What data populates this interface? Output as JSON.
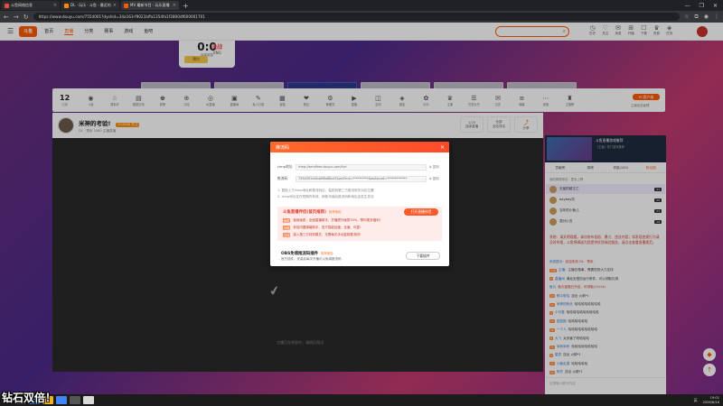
{
  "browser": {
    "tabs": [
      {
        "title": "斗鱼网络信息",
        "color": "#e74c3c",
        "active": false
      },
      {
        "title": "DL · 玩乐 · 斗鱼 · 最近的直播",
        "color": "#ff8a00",
        "active": false
      },
      {
        "title": "MV 最新节目 - 玩乐直播 DL · 玩乐直播",
        "color": "#ff5a00",
        "active": true
      }
    ],
    "url": "https://www.douyu.com/7554001?dyshid=34a163-f9021bffa1354fa1f2800df600001701",
    "new_tab": "+",
    "win_min": "—",
    "win_max": "❐",
    "win_close": "✕"
  },
  "site": {
    "logo": "斗鱼",
    "nav": [
      "首页",
      "直播",
      "分类",
      "赛事",
      "游戏",
      "鱼吧"
    ],
    "nav_active_index": 1,
    "header_icons": [
      {
        "glyph": "◷",
        "label": "历史"
      },
      {
        "glyph": "♡",
        "label": "关注"
      },
      {
        "glyph": "✉",
        "label": "消息"
      },
      {
        "glyph": "⊞",
        "label": "开播"
      },
      {
        "glyph": "☐",
        "label": "下载"
      },
      {
        "glyph": "♛",
        "label": "贵族"
      },
      {
        "glyph": "◈",
        "label": "任务"
      }
    ]
  },
  "promo": {
    "score": "0:0",
    "score_label": "赢者奖励",
    "button": "预约",
    "kw": "决战",
    "kw_sub": "KNG"
  },
  "room_buttons": [
    "官方直播间",
    "Mr.Gemini直播间",
    "DL - 预米直播间",
    "eSw石苏苏直播间",
    "滴滴直播间",
    "出牌ove直播间"
  ],
  "room_active_index": 2,
  "roombar": {
    "count": "12",
    "count_label": "订阅",
    "tools": [
      "斗鱼",
      "周末好",
      "数据分析",
      "新榜",
      "订阅",
      "AI直播",
      "直播间",
      "私人订制",
      "宝箱",
      "粉丝",
      "管理员",
      "直播",
      "空间",
      "赚金",
      "乐乐",
      "主播",
      "任务大厅",
      "日志",
      "弹幕",
      "其他",
      "主播榜"
    ],
    "pc_btn": "PC客户端",
    "pc_sub": "主播信息管理"
  },
  "streamer": {
    "title": "米神的考验!",
    "fans": "522938",
    "fans_tag": "关注",
    "meta": "DL · 预米   1080   主播直播",
    "box1_value": "1/25",
    "box1_label": "连续直播",
    "box2_value": "全部",
    "box2_label": "全站排名",
    "box3_label": "分享"
  },
  "player": {
    "offline": "主播正在休息中，请稍后再试"
  },
  "modal": {
    "title": "推流码",
    "close": "×",
    "rtmp_label": "rtmp地址",
    "rtmp_value": "rtmp://sendfree.douyu.com/live",
    "code_label": "推流码",
    "code_value": "7554001rsSbs8f6a8Bcd?&wsTime=**********&wsSecret=*************",
    "copy": "复制",
    "note1": "1. 复制上方rtmp地址和推流码后，粘贴到第三方推流软件对应位置",
    "note2": "2. rtmp地址仅在短期内有效，刷新页面后推流码和地址会发生变化",
    "helper_title": "斗鱼直播伴侣(首页推荐)",
    "helper_tag": "推荐使用",
    "helper_btn": "打开直播伴侣",
    "helper_lines": [
      {
        "badge": "画质",
        "text": "极致画质，全面直播助手，开播提升画质30%，帮你更多福利!"
      },
      {
        "badge": "功能",
        "text": "伴侣内置弹幕助手，官方智能加速、全面、可靠!"
      },
      {
        "badge": "互动",
        "text": "接入第三方特效模式，无需每天手动复制推流码!"
      }
    ],
    "obs_title": "OBS免填推流码插件",
    "obs_tag": "推荐使用",
    "obs_desc": "官方插件，安装后每次开播可以免填推流码",
    "obs_btn": "下载插件"
  },
  "right_panel": {
    "ad_title": "斗鱼直播游戏推荐",
    "ad_desc": "《王者》热门游戏推荐",
    "tabs": [
      "贡献榜",
      "周榜",
      "贵族(180)",
      "粉丝团"
    ],
    "tabs_active_index": 3,
    "rank_tip": "我的周榜排名：暂未上榜",
    "ranks": [
      {
        "name": "无敌的超王乙",
        "level": "31",
        "gold": true
      },
      {
        "name": "baybay坑",
        "level": "25",
        "gold": false
      },
      {
        "name": "当年的小鱼儿",
        "level": "21",
        "gold": false
      },
      {
        "name": "混分小丑",
        "level": "19",
        "gold": false
      }
    ],
    "notice": "系统：请文明观看，请勿发布低俗、暴力、违法内容；如发现违规行为请及时举报，斗鱼将竭诚为您提供优质体验服务，请点击查看直播规范。",
    "chats": [
      {
        "badge": "",
        "user": "系统提示:",
        "text": "欢迎来到 DL · 预米",
        "sys": true
      },
      {
        "badge": "公告",
        "user": "主播:",
        "text": "主播在做事，需要您的大力支持",
        "sys": false
      },
      {
        "badge": "2",
        "user": "直播间",
        "text": "满足无限的运行条件，可以领取礼物",
        "sys": false
      },
      {
        "badge": "",
        "user": "鱼丸",
        "text": "鱼丸宝箱已开启，可领取(13/14)",
        "sys": true
      },
      {
        "badge": "18",
        "user": "醉中哈哈",
        "text": "送出 火箭*1",
        "sys": false
      },
      {
        "badge": "22",
        "user": "米神的粉丝",
        "text": "哈哈哈哈哈哈哈哈",
        "sys": false
      },
      {
        "badge": "9",
        "user": "小可爱",
        "text": "哈哈哈哈哈哈哈哈哈哈",
        "sys": false
      },
      {
        "badge": "12",
        "user": "甜甜圈",
        "text": "哈哈哈哈哈哈",
        "sys": false
      },
      {
        "badge": "30",
        "user": "一个人",
        "text": "哈哈哈哈哈哈哈哈哈",
        "sys": false
      },
      {
        "badge": "8",
        "user": "大飞",
        "text": "太厉害了吧哈哈哈",
        "sys": false
      },
      {
        "badge": "15",
        "user": "米粉米粉",
        "text": "哈哈哈哈哈哈哈哈",
        "sys": false
      },
      {
        "badge": "6",
        "user": "星辰",
        "text": "送出 火箭*1",
        "sys": false
      },
      {
        "badge": "11",
        "user": "小鹿乱撞",
        "text": "哈哈哈哈哈",
        "sys": false
      },
      {
        "badge": "20",
        "user": "阿甘",
        "text": "送出 火箭*1",
        "sys": false
      }
    ],
    "input_placeholder": "这里输入聊天内容"
  },
  "taskbar": {
    "time": "19:01",
    "date": "2026/6/16",
    "tray": "英"
  },
  "caption": "钻石双倍！"
}
